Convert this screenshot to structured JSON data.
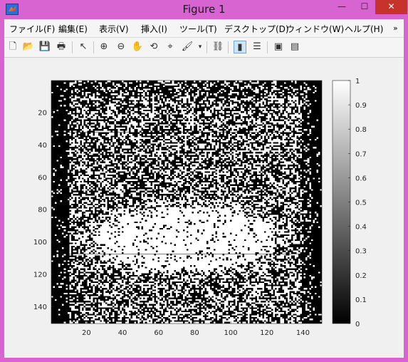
{
  "window": {
    "title": "Figure 1",
    "minimize_glyph": "—",
    "maximize_glyph": "☐",
    "close_glyph": "✕"
  },
  "menu": [
    "ファイル(F)",
    "編集(E)",
    "表示(V)",
    "挿入(I)",
    "ツール(T)",
    "デスクトップ(D)",
    "ウィンドウ(W)",
    "ヘルプ(H)"
  ],
  "menu_overflow": "»",
  "toolbar": [
    {
      "icon": "new-figure-icon",
      "glyph": "🗋"
    },
    {
      "icon": "open-file-icon",
      "glyph": "📂"
    },
    {
      "icon": "save-icon",
      "glyph": "💾"
    },
    {
      "icon": "print-icon",
      "glyph": "🖶"
    },
    {
      "icon": "pointer-icon",
      "glyph": "↖"
    },
    {
      "icon": "zoom-in-icon",
      "glyph": "⊕"
    },
    {
      "icon": "zoom-out-icon",
      "glyph": "⊖"
    },
    {
      "icon": "pan-hand-icon",
      "glyph": "✋"
    },
    {
      "icon": "rotate-3d-icon",
      "glyph": "⟲"
    },
    {
      "icon": "data-cursor-icon",
      "glyph": "⌖"
    },
    {
      "icon": "brush-icon",
      "glyph": "🖌"
    },
    {
      "icon": "link-plot-icon",
      "glyph": "⛓"
    },
    {
      "icon": "insert-colorbar-icon",
      "glyph": "▮"
    },
    {
      "icon": "insert-legend-icon",
      "glyph": "☰"
    },
    {
      "icon": "hide-plot-tools-icon",
      "glyph": "▣"
    },
    {
      "icon": "show-plot-tools-icon",
      "glyph": "▤"
    }
  ],
  "colors": {
    "titlebar": "#d764d0",
    "close": "#c7332b",
    "figure_bg": "#f0f0f0"
  },
  "chart_data": {
    "type": "heatmap",
    "colormap": "gray",
    "x_ticks": [
      "20",
      "40",
      "60",
      "80",
      "100",
      "120",
      "140"
    ],
    "y_ticks": [
      "20",
      "40",
      "60",
      "80",
      "100",
      "120",
      "140"
    ],
    "xlim": [
      0.5,
      150.5
    ],
    "ylim": [
      0.5,
      150.5
    ],
    "colorbar": {
      "range": [
        0,
        1
      ],
      "ticks": [
        "0",
        "0.1",
        "0.2",
        "0.3",
        "0.4",
        "0.5",
        "0.6",
        "0.7",
        "0.8",
        "0.9",
        "1"
      ]
    }
  }
}
